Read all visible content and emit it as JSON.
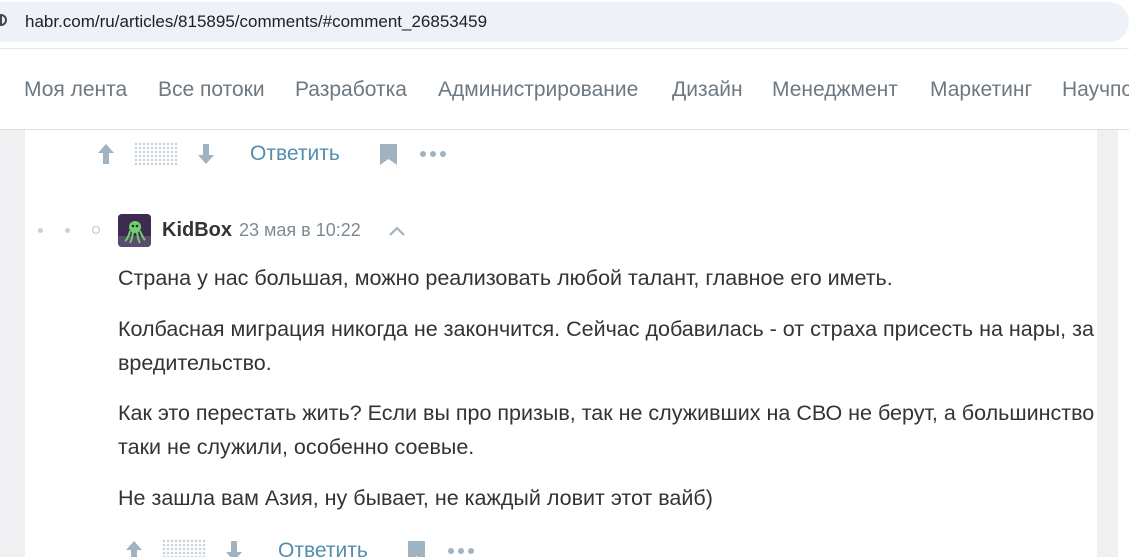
{
  "browser": {
    "url": "habr.com/ru/articles/815895/comments/#comment_26853459"
  },
  "nav": {
    "items": [
      "Моя лента",
      "Все потоки",
      "Разработка",
      "Администрирование",
      "Дизайн",
      "Менеджмент",
      "Маркетинг",
      "Научпоп"
    ]
  },
  "prev_comment": {
    "reply_label": "Ответить"
  },
  "comment": {
    "author": "KidBox",
    "timestamp": "23 мая в 10:22",
    "paragraphs": [
      "Страна у нас большая, можно реализовать любой талант, главное его иметь.",
      "Колбасная миграция никогда не закончится. Сейчас добавилась - от страха присесть на нары, за вредительство.",
      "Как это перестать жить? Если вы про призыв, так не служивших на СВО не берут, а большинство таки не служили, особенно соевые.",
      "Не зашла вам Азия, ну бывает, не каждый ловит этот вайб)"
    ],
    "reply_label": "Ответить"
  },
  "icons": {
    "upvote": "arrow-up-icon",
    "downvote": "arrow-down-icon",
    "bookmark": "bookmark-icon",
    "more": "more-dots-icon",
    "collapse": "chevron-up-icon",
    "site": "site-icon"
  },
  "colors": {
    "link": "#548eaa",
    "nav_text": "#6c7882",
    "icon_muted": "#9fb3c2",
    "body_text": "#333333"
  }
}
